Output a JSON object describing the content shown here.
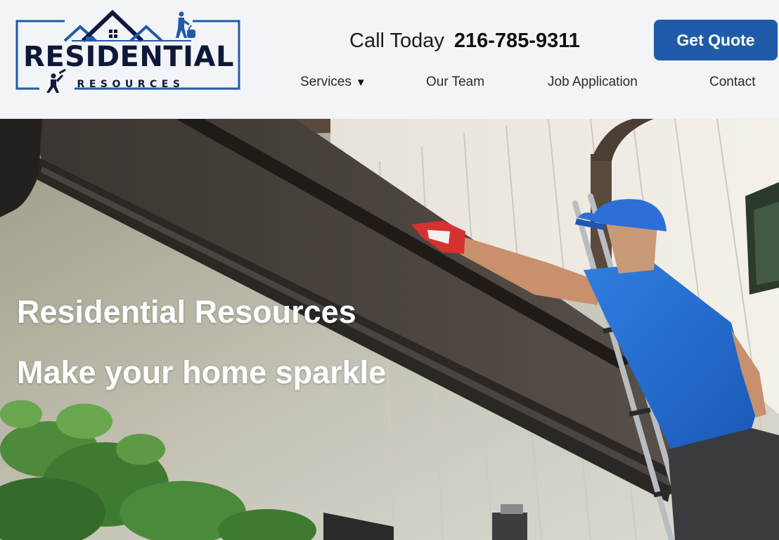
{
  "brand": {
    "title": "RESIDENTIAL",
    "subtitle": "RESOURCES",
    "colors": {
      "navy": "#10183a",
      "blue": "#1f5ba8"
    }
  },
  "header": {
    "call_label": "Call Today",
    "phone": "216-785-9311",
    "quote_button": "Get Quote"
  },
  "nav": {
    "items": [
      {
        "label": "Services",
        "has_dropdown": true,
        "caret": "▼"
      },
      {
        "label": "Our Team"
      },
      {
        "label": "Job Application"
      },
      {
        "label": "Contact"
      }
    ]
  },
  "hero": {
    "title": "Residential Resources",
    "subtitle": "Make your home sparkle",
    "image_alt": "worker-cleaning-gutter-photo"
  },
  "icons": {
    "logo_house": "house-roof-icon",
    "logo_worker": "window-washer-icon",
    "logo_vacuum": "vacuum-cleaner-icon",
    "dropdown": "caret-down-icon"
  }
}
